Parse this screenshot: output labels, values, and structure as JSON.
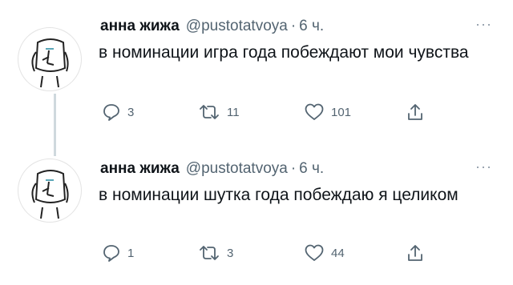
{
  "tweets": [
    {
      "name": "анна жижа",
      "handle": "@pustotatvoya",
      "separator": "·",
      "time": "6 ч.",
      "text": "в номинации игра года побеждают мои чувства",
      "more": "···",
      "replies": "3",
      "retweets": "11",
      "likes": "101"
    },
    {
      "name": "анна жижа",
      "handle": "@pustotatvoya",
      "separator": "·",
      "time": "6 ч.",
      "text": "в номинации шутка года побеждаю я целиком",
      "more": "···",
      "replies": "1",
      "retweets": "3",
      "likes": "44"
    }
  ],
  "icons": {
    "reply": "reply-icon",
    "retweet": "retweet-icon",
    "like": "heart-icon",
    "share": "share-icon",
    "more": "more-icon"
  },
  "colors": {
    "text": "#0f1419",
    "secondary": "#536471",
    "thread_line": "#cfd9de"
  }
}
